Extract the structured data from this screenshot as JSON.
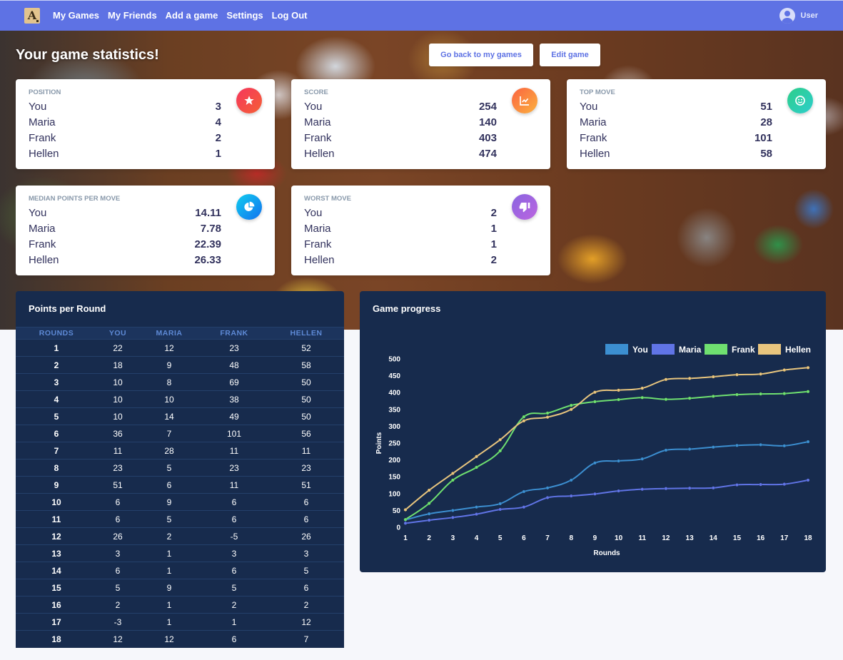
{
  "nav": {
    "logo_letter": "A",
    "links": [
      "My Games",
      "My Friends",
      "Add a game",
      "Settings",
      "Log Out"
    ],
    "user_label": "User"
  },
  "hero": {
    "title": "Your game statistics!",
    "back_button": "Go back to my games",
    "edit_button": "Edit game"
  },
  "cards": [
    {
      "title": "Position",
      "icon": "star-icon",
      "color": "#f5365c",
      "rows": [
        [
          "You",
          "3"
        ],
        [
          "Maria",
          "4"
        ],
        [
          "Frank",
          "2"
        ],
        [
          "Hellen",
          "1"
        ]
      ]
    },
    {
      "title": "Score",
      "icon": "chart-bar-icon",
      "color": "#fb6340",
      "rows": [
        [
          "You",
          "254"
        ],
        [
          "Maria",
          "140"
        ],
        [
          "Frank",
          "403"
        ],
        [
          "Hellen",
          "474"
        ]
      ]
    },
    {
      "title": "Top Move",
      "icon": "smile-icon",
      "color": "#2dce89",
      "rows": [
        [
          "You",
          "51"
        ],
        [
          "Maria",
          "28"
        ],
        [
          "Frank",
          "101"
        ],
        [
          "Hellen",
          "58"
        ]
      ]
    },
    {
      "title": "Median points per move",
      "icon": "pie-chart-icon",
      "color": "#11cdef",
      "rows": [
        [
          "You",
          "14.11"
        ],
        [
          "Maria",
          "7.78"
        ],
        [
          "Frank",
          "22.39"
        ],
        [
          "Hellen",
          "26.33"
        ]
      ]
    },
    {
      "title": "Worst move",
      "icon": "thumbs-down-icon",
      "color": "#8965e0",
      "rows": [
        [
          "You",
          "2"
        ],
        [
          "Maria",
          "1"
        ],
        [
          "Frank",
          "1"
        ],
        [
          "Hellen",
          "2"
        ]
      ]
    }
  ],
  "table": {
    "title": "Points per Round",
    "headers": [
      "ROUNDS",
      "YOU",
      "MARIA",
      "FRANK",
      "HELLEN"
    ],
    "rows": [
      [
        "1",
        "22",
        "12",
        "23",
        "52"
      ],
      [
        "2",
        "18",
        "9",
        "48",
        "58"
      ],
      [
        "3",
        "10",
        "8",
        "69",
        "50"
      ],
      [
        "4",
        "10",
        "10",
        "38",
        "50"
      ],
      [
        "5",
        "10",
        "14",
        "49",
        "50"
      ],
      [
        "6",
        "36",
        "7",
        "101",
        "56"
      ],
      [
        "7",
        "11",
        "28",
        "11",
        "11"
      ],
      [
        "8",
        "23",
        "5",
        "23",
        "23"
      ],
      [
        "9",
        "51",
        "6",
        "11",
        "51"
      ],
      [
        "10",
        "6",
        "9",
        "6",
        "6"
      ],
      [
        "11",
        "6",
        "5",
        "6",
        "6"
      ],
      [
        "12",
        "26",
        "2",
        "-5",
        "26"
      ],
      [
        "13",
        "3",
        "1",
        "3",
        "3"
      ],
      [
        "14",
        "6",
        "1",
        "6",
        "5"
      ],
      [
        "15",
        "5",
        "9",
        "5",
        "6"
      ],
      [
        "16",
        "2",
        "1",
        "2",
        "2"
      ],
      [
        "17",
        "-3",
        "1",
        "1",
        "12"
      ],
      [
        "18",
        "12",
        "12",
        "6",
        "7"
      ]
    ]
  },
  "chart_title": "Game progress",
  "chart_data": {
    "type": "line",
    "x": [
      1,
      2,
      3,
      4,
      5,
      6,
      7,
      8,
      9,
      10,
      11,
      12,
      13,
      14,
      15,
      16,
      17,
      18
    ],
    "xlabel": "Rounds",
    "ylabel": "Points",
    "ylim": [
      0,
      500
    ],
    "yticks": [
      0,
      50,
      100,
      150,
      200,
      250,
      300,
      350,
      400,
      450,
      500
    ],
    "legend_position": "top-right",
    "series": [
      {
        "name": "You",
        "color": "#3c8fd1",
        "values": [
          22,
          40,
          50,
          60,
          70,
          106,
          117,
          140,
          191,
          197,
          203,
          229,
          232,
          238,
          243,
          245,
          242,
          254
        ]
      },
      {
        "name": "Maria",
        "color": "#6074e6",
        "values": [
          12,
          21,
          29,
          39,
          53,
          60,
          88,
          93,
          99,
          108,
          113,
          115,
          116,
          117,
          126,
          127,
          128,
          140
        ]
      },
      {
        "name": "Frank",
        "color": "#6fe070",
        "values": [
          23,
          71,
          140,
          178,
          227,
          328,
          339,
          362,
          373,
          379,
          385,
          380,
          383,
          389,
          394,
          396,
          397,
          403
        ]
      },
      {
        "name": "Hellen",
        "color": "#e8c57e",
        "values": [
          52,
          110,
          160,
          210,
          260,
          316,
          327,
          350,
          401,
          407,
          413,
          439,
          442,
          447,
          453,
          455,
          467,
          474
        ]
      }
    ]
  }
}
